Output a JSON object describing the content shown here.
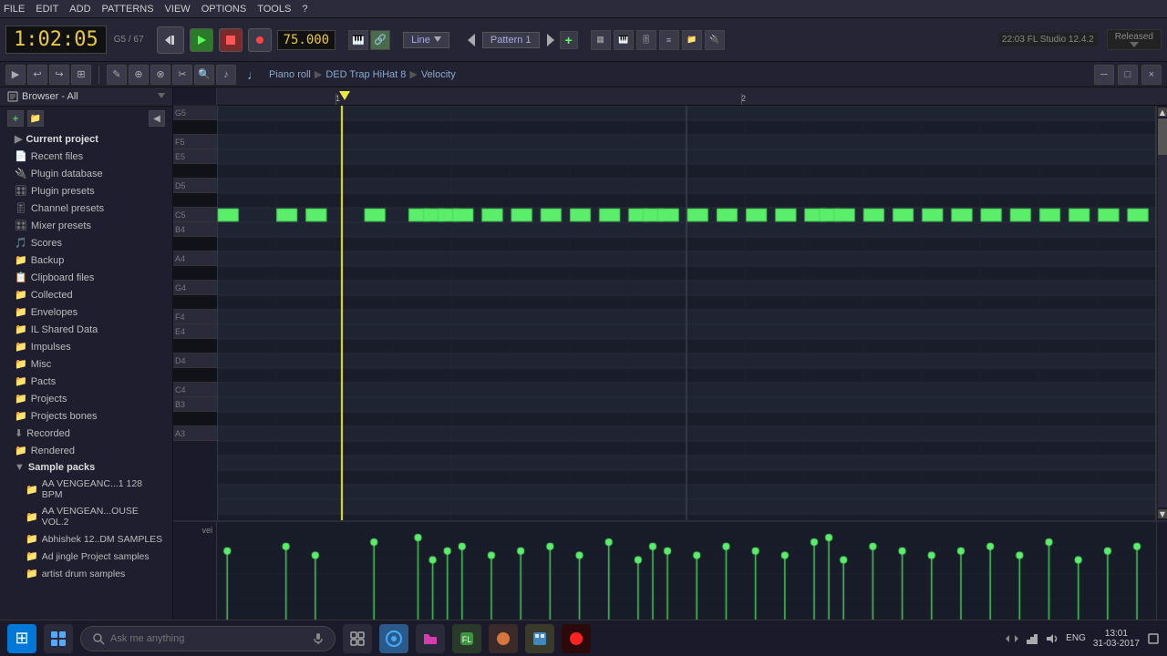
{
  "menuBar": {
    "items": [
      "FILE",
      "EDIT",
      "ADD",
      "PATTERNS",
      "VIEW",
      "OPTIONS",
      "TOOLS",
      "?"
    ]
  },
  "transport": {
    "time": "1:02:05",
    "noteName": "G5",
    "noteNum": "67",
    "bpm": "75.000",
    "patternLabel": "Pattern 1",
    "lineLabel": "Line",
    "version": "22:03  FL Studio 12.4.2",
    "releaseStatus": "Released"
  },
  "pianoRoll": {
    "breadcrumb": [
      "Piano roll",
      "DED Trap HiHat 8",
      "Velocity"
    ],
    "windowTitle": "Velocity"
  },
  "sidebar": {
    "browserLabel": "Browser - All",
    "items": [
      {
        "label": "Current project",
        "icon": "📁",
        "type": "root"
      },
      {
        "label": "Recent files",
        "icon": "📄",
        "type": "item"
      },
      {
        "label": "Plugin database",
        "icon": "🔌",
        "type": "item"
      },
      {
        "label": "Plugin presets",
        "icon": "🎛",
        "type": "item"
      },
      {
        "label": "Channel presets",
        "icon": "🎚",
        "type": "item"
      },
      {
        "label": "Mixer presets",
        "icon": "🎛",
        "type": "item"
      },
      {
        "label": "Scores",
        "icon": "🎵",
        "type": "item"
      },
      {
        "label": "Backup",
        "icon": "📁",
        "type": "item"
      },
      {
        "label": "Clipboard files",
        "icon": "📋",
        "type": "item"
      },
      {
        "label": "Collected",
        "icon": "📁",
        "type": "item"
      },
      {
        "label": "Envelopes",
        "icon": "📁",
        "type": "item"
      },
      {
        "label": "IL Shared Data",
        "icon": "📁",
        "type": "item"
      },
      {
        "label": "Impulses",
        "icon": "📁",
        "type": "item"
      },
      {
        "label": "Misc",
        "icon": "📁",
        "type": "item"
      },
      {
        "label": "Pacts",
        "icon": "📁",
        "type": "item"
      },
      {
        "label": "Projects",
        "icon": "📁",
        "type": "item"
      },
      {
        "label": "Projects bones",
        "icon": "📁",
        "type": "item"
      },
      {
        "label": "Recorded",
        "icon": "⬇",
        "type": "item"
      },
      {
        "label": "Rendered",
        "icon": "📁",
        "type": "item"
      },
      {
        "label": "Sample packs",
        "icon": "📁",
        "type": "root",
        "expanded": true
      },
      {
        "label": "AA VENGEANC...1 128 BPM",
        "icon": "📁",
        "type": "sub"
      },
      {
        "label": "AA VENGEAN...OUSE VOL.2",
        "icon": "📁",
        "type": "sub"
      },
      {
        "label": "Abhishek 12..DM SAMPLES",
        "icon": "📁",
        "type": "sub"
      },
      {
        "label": "Ad jingle Project samples",
        "icon": "📁",
        "type": "sub"
      },
      {
        "label": "artist drum samples",
        "icon": "📁",
        "type": "sub"
      }
    ]
  },
  "pianoKeys": [
    {
      "label": "G5",
      "type": "white"
    },
    {
      "label": "",
      "type": "black"
    },
    {
      "label": "F5",
      "type": "white"
    },
    {
      "label": "E5",
      "type": "white"
    },
    {
      "label": "",
      "type": "black"
    },
    {
      "label": "D5",
      "type": "white"
    },
    {
      "label": "",
      "type": "black"
    },
    {
      "label": "C5",
      "type": "white"
    },
    {
      "label": "B4",
      "type": "white"
    },
    {
      "label": "",
      "type": "black"
    },
    {
      "label": "A4",
      "type": "white"
    },
    {
      "label": "",
      "type": "black"
    },
    {
      "label": "G4",
      "type": "white"
    },
    {
      "label": "",
      "type": "black"
    },
    {
      "label": "F4",
      "type": "white"
    },
    {
      "label": "E4",
      "type": "white"
    },
    {
      "label": "",
      "type": "black"
    },
    {
      "label": "D4",
      "type": "white"
    },
    {
      "label": "",
      "type": "black"
    },
    {
      "label": "C4",
      "type": "white"
    },
    {
      "label": "B3",
      "type": "white"
    },
    {
      "label": "",
      "type": "black"
    },
    {
      "label": "A3",
      "type": "white"
    }
  ],
  "taskbar": {
    "searchPlaceholder": "Ask me anything",
    "clock": "13:01",
    "date": "31-03-2017",
    "language": "ENG"
  }
}
